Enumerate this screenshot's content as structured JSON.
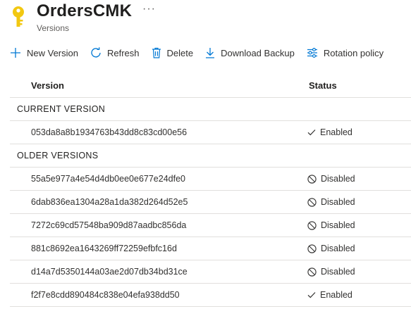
{
  "header": {
    "title": "OrdersCMK",
    "subtitle": "Versions",
    "more": "···"
  },
  "toolbar": {
    "new_version": "New Version",
    "refresh": "Refresh",
    "delete": "Delete",
    "download_backup": "Download Backup",
    "rotation_policy": "Rotation policy"
  },
  "table": {
    "col_version": "Version",
    "col_status": "Status",
    "current_group": "CURRENT VERSION",
    "older_group": "OLDER VERSIONS",
    "current": [
      {
        "version": "053da8a8b1934763b43dd8c83cd00e56",
        "status": "Enabled"
      }
    ],
    "older": [
      {
        "version": "55a5e977a4e54d4db0ee0e677e24dfe0",
        "status": "Disabled"
      },
      {
        "version": "6dab836ea1304a28a1da382d264d52e5",
        "status": "Disabled"
      },
      {
        "version": "7272c69cd57548ba909d87aadbc856da",
        "status": "Disabled"
      },
      {
        "version": "881c8692ea1643269ff72259efbfc16d",
        "status": "Disabled"
      },
      {
        "version": "d14a7d5350144a03ae2d07db34bd31ce",
        "status": "Disabled"
      },
      {
        "version": "f2f7e8cdd890484c838e04efa938dd50",
        "status": "Enabled"
      }
    ]
  },
  "colors": {
    "accent": "#0078d4",
    "key": "#f2c811"
  },
  "icons": {
    "key": "key-icon",
    "new_version": "plus-icon",
    "refresh": "refresh-icon",
    "delete": "trash-icon",
    "download": "download-icon",
    "rotation": "sliders-icon",
    "enabled": "check-icon",
    "disabled": "blocked-icon"
  }
}
